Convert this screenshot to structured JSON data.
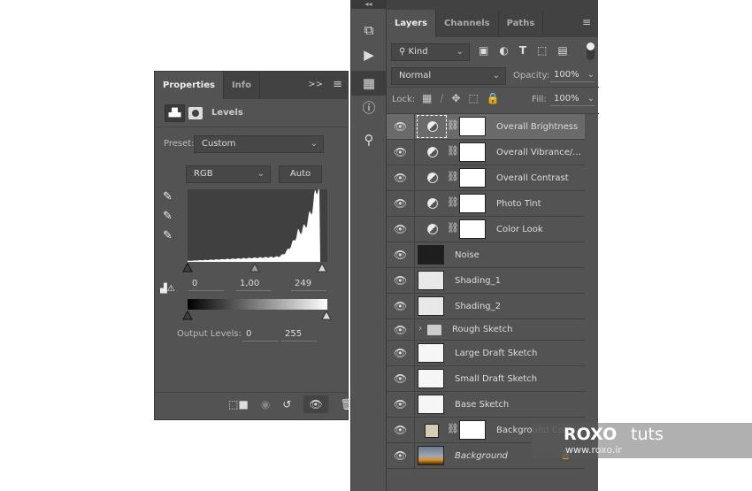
{
  "properties": {
    "tabs": [
      "Properties",
      "Info"
    ],
    "panel_menu": "≡",
    "collapse": ">>",
    "title": "Levels",
    "preset_label": "Preset:",
    "preset_value": "Custom",
    "channel": "RGB",
    "auto_label": "Auto",
    "input_levels": {
      "black": "0",
      "mid": "1,00",
      "white": "249"
    },
    "output_label": "Output Levels:",
    "output_levels": {
      "black": "0",
      "white": "255"
    },
    "footer_icons": [
      "clip-to-layer-icon",
      "view-previous-icon",
      "reset-icon",
      "visibility-icon",
      "trash-icon"
    ]
  },
  "toolbar_icons": [
    "3d-icon",
    "play-icon",
    "properties-icon",
    "info-icon",
    "clone-source-icon"
  ],
  "layers": {
    "tabs": [
      "Layers",
      "Channels",
      "Paths"
    ],
    "filter_kind": "Kind",
    "blend_mode": "Normal",
    "opacity_label": "Opacity:",
    "opacity": "100%",
    "lock_label": "Lock:",
    "fill_label": "Fill:",
    "fill": "100%",
    "items": [
      {
        "name": "Overall Brightness",
        "type": "adjustment",
        "selected": true
      },
      {
        "name": "Overall Vibrance/...",
        "type": "adjustment"
      },
      {
        "name": "Overall Contrast",
        "type": "adjustment"
      },
      {
        "name": "Photo Tint",
        "type": "adjustment"
      },
      {
        "name": "Color Look",
        "type": "adjustment"
      },
      {
        "name": "Noise",
        "type": "pixel",
        "thumb": "#1e1e1e"
      },
      {
        "name": "Shading_1",
        "type": "pixel",
        "thumb": "#e8e8e8"
      },
      {
        "name": "Shading_2",
        "type": "pixel",
        "thumb": "#e8e8e8"
      },
      {
        "name": "Rough Sketch",
        "type": "group"
      },
      {
        "name": "Large Draft Sketch",
        "type": "pixel",
        "thumb": "#f6f6f6"
      },
      {
        "name": "Small Draft Sketch",
        "type": "pixel",
        "thumb": "#f6f6f6"
      },
      {
        "name": "Base Sketch",
        "type": "pixel",
        "thumb": "#f6f6f6"
      },
      {
        "name": "Background Color",
        "type": "fill",
        "thumb": "#d6cdb0"
      },
      {
        "name": "Background",
        "type": "background",
        "locked": true
      }
    ]
  },
  "watermark": {
    "brand": "ROXO",
    "suffix": "tuts",
    "url": "www.roxo.ir"
  }
}
